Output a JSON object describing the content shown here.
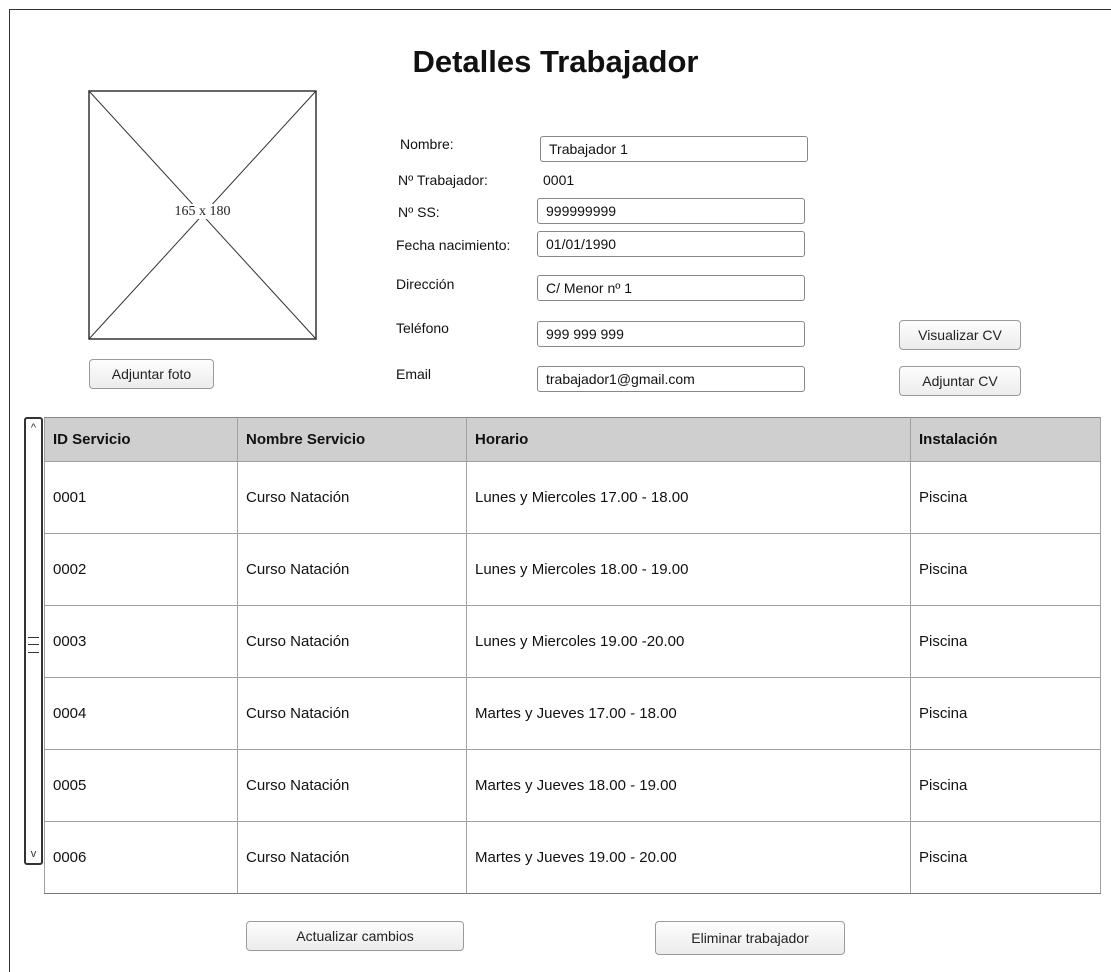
{
  "title": "Detalles Trabajador",
  "photo": {
    "placeholder": "165 x 180",
    "attach_label": "Adjuntar foto"
  },
  "form": {
    "nombre_label": "Nombre:",
    "nombre_value": "Trabajador 1",
    "numero_label": "Nº Trabajador:",
    "numero_value": "0001",
    "ss_label": "Nº SS:",
    "ss_value": "999999999",
    "fecha_label": "Fecha nacimiento:",
    "fecha_value": "01/01/1990",
    "direccion_label": "Dirección",
    "direccion_value": "C/ Menor nº 1",
    "telefono_label": "Teléfono",
    "telefono_value": "999 999 999",
    "email_label": "Email",
    "email_value": "trabajador1@gmail.com"
  },
  "cv": {
    "view_label": "Visualizar CV",
    "attach_label": "Adjuntar CV"
  },
  "table": {
    "headers": [
      "ID Servicio",
      "Nombre Servicio",
      "Horario",
      "Instalación"
    ],
    "rows": [
      [
        "0001",
        "Curso Natación",
        "Lunes y Miercoles 17.00 - 18.00",
        "Piscina"
      ],
      [
        "0002",
        "Curso Natación",
        "Lunes y Miercoles 18.00 - 19.00",
        "Piscina"
      ],
      [
        "0003",
        "Curso Natación",
        "Lunes y Miercoles 19.00 -20.00",
        "Piscina"
      ],
      [
        "0004",
        "Curso Natación",
        "Martes y Jueves 17.00 - 18.00",
        "Piscina"
      ],
      [
        "0005",
        "Curso Natación",
        "Martes y Jueves 18.00 - 19.00",
        "Piscina"
      ],
      [
        "0006",
        "Curso Natación",
        "Martes y Jueves 19.00 - 20.00",
        "Piscina"
      ]
    ]
  },
  "scrollbar": {
    "up_icon": "chevron-up-icon",
    "down_icon": "chevron-down-icon"
  },
  "actions": {
    "update_label": "Actualizar cambios",
    "delete_label": "Eliminar trabajador"
  }
}
